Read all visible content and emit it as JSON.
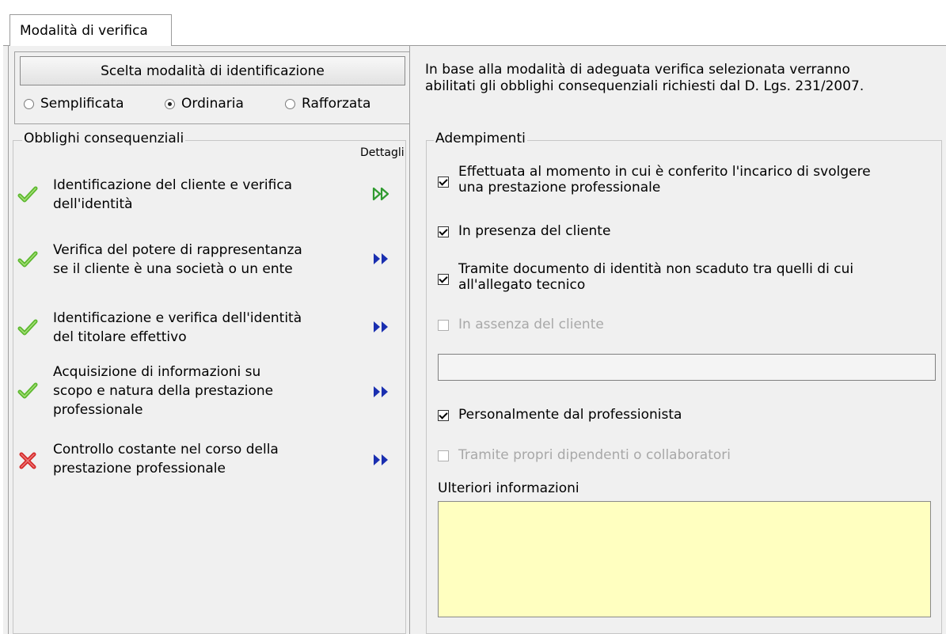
{
  "tab": {
    "label": "Modalità di verifica"
  },
  "identification": {
    "button_label": "Scelta modalità di identificazione",
    "options": [
      {
        "label": "Semplificata",
        "selected": false
      },
      {
        "label": "Ordinaria",
        "selected": true
      },
      {
        "label": "Rafforzata",
        "selected": false
      }
    ]
  },
  "obblighi": {
    "title": "Obblighi consequenziali",
    "details_header": "Dettagli",
    "items": [
      {
        "lines": [
          "Identificazione del cliente e verifica",
          "dell'identità"
        ],
        "status": "check-icon",
        "detail_icon": "double-arrow-green-icon"
      },
      {
        "lines": [
          "Verifica del potere di rappresentanza",
          "se il cliente è una società o un ente"
        ],
        "status": "check-icon",
        "detail_icon": "double-arrow-blue-icon"
      },
      {
        "lines": [
          "Identificazione e verifica dell'identità",
          "del titolare effettivo"
        ],
        "status": "check-icon",
        "detail_icon": "double-arrow-blue-icon"
      },
      {
        "lines": [
          "Acquisizione di informazioni su",
          "scopo e natura della prestazione",
          "professionale"
        ],
        "status": "check-icon",
        "detail_icon": "double-arrow-blue-icon"
      },
      {
        "lines": [
          "Controllo costante nel corso della",
          "prestazione professionale"
        ],
        "status": "cross-icon",
        "detail_icon": "double-arrow-blue-icon"
      }
    ]
  },
  "info": {
    "lines": [
      "In base alla modalità di adeguata verifica selezionata verranno",
      "abilitati gli obblighi consequenziali richiesti dal  D. Lgs. 231/2007."
    ]
  },
  "adempimenti": {
    "title": "Adempimenti",
    "checkboxes": [
      {
        "lines": [
          "Effettuata al momento in cui è conferito l'incarico di svolgere",
          "una prestazione professionale"
        ],
        "checked": true,
        "enabled": true
      },
      {
        "lines": [
          "In presenza del cliente"
        ],
        "checked": true,
        "enabled": true
      },
      {
        "lines": [
          "Tramite documento di identità non scaduto tra quelli di cui",
          "all'allegato tecnico"
        ],
        "checked": true,
        "enabled": true
      },
      {
        "lines": [
          "In assenza del cliente"
        ],
        "checked": false,
        "enabled": false
      },
      {
        "lines": [
          "Personalmente dal professionista"
        ],
        "checked": true,
        "enabled": true
      },
      {
        "lines": [
          "Tramite propri dipendenti o collaboratori"
        ],
        "checked": false,
        "enabled": false
      }
    ],
    "text_field_value": "",
    "ulteriori_label": "Ulteriori informazioni",
    "ulteriori_value": ""
  },
  "colors": {
    "panel_bg": "#f0f0f0",
    "textarea_bg": "#ffffc0",
    "check_green": "#5cb82e",
    "cross_red": "#d42a2a",
    "arrow_blue": "#1a2fb0",
    "arrow_green": "#2f9a2f"
  }
}
